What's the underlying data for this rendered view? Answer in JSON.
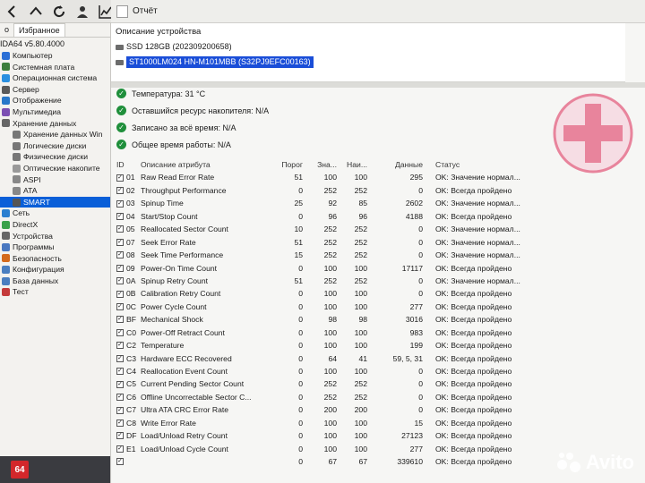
{
  "toolbar": {
    "buttons": [
      "back-icon",
      "up-icon",
      "refresh-icon",
      "user-icon",
      "chart-icon"
    ]
  },
  "report_bar": {
    "label": "Отчёт"
  },
  "sidebar": {
    "tabs": [
      "о",
      "Избранное"
    ],
    "app_version": "IDA64 v5.80.4000",
    "items": [
      {
        "label": "Компьютер",
        "indent": 1,
        "icon": "computer-icon",
        "color": "#2b6fd6"
      },
      {
        "label": "Системная плата",
        "indent": 1,
        "icon": "motherboard-icon",
        "color": "#3d7f3d"
      },
      {
        "label": "Операционная система",
        "indent": 1,
        "icon": "windows-icon",
        "color": "#2a8fe0"
      },
      {
        "label": "Сервер",
        "indent": 1,
        "icon": "server-icon",
        "color": "#5a5a5a"
      },
      {
        "label": "Отображение",
        "indent": 1,
        "icon": "display-icon",
        "color": "#2877c9"
      },
      {
        "label": "Мультимедиа",
        "indent": 1,
        "icon": "multimedia-icon",
        "color": "#7b4fb3"
      },
      {
        "label": "Хранение данных",
        "indent": 1,
        "icon": "storage-icon",
        "color": "#666666"
      },
      {
        "label": "Хранение данных Win",
        "indent": 2,
        "icon": "disk-icon",
        "color": "#777777"
      },
      {
        "label": "Логические диски",
        "indent": 2,
        "icon": "disk-icon",
        "color": "#777777"
      },
      {
        "label": "Физические диски",
        "indent": 2,
        "icon": "disk-icon",
        "color": "#777777"
      },
      {
        "label": "Оптические накопите",
        "indent": 2,
        "icon": "optical-icon",
        "color": "#999999"
      },
      {
        "label": "ASPI",
        "indent": 2,
        "icon": "aspi-icon",
        "color": "#888888"
      },
      {
        "label": "ATA",
        "indent": 2,
        "icon": "ata-icon",
        "color": "#888888"
      },
      {
        "label": "SMART",
        "indent": 2,
        "icon": "smart-icon",
        "color": "#555555",
        "selected": true
      },
      {
        "label": "Сеть",
        "indent": 1,
        "icon": "network-icon",
        "color": "#2b7fd0"
      },
      {
        "label": "DirectX",
        "indent": 1,
        "icon": "directx-icon",
        "color": "#3aa14a"
      },
      {
        "label": "Устройства",
        "indent": 1,
        "icon": "devices-icon",
        "color": "#666666"
      },
      {
        "label": "Программы",
        "indent": 1,
        "icon": "programs-icon",
        "color": "#4a78c0"
      },
      {
        "label": "Безопасность",
        "indent": 1,
        "icon": "security-icon",
        "color": "#d46a1c"
      },
      {
        "label": "Конфигурация",
        "indent": 1,
        "icon": "config-icon",
        "color": "#4a7ec0"
      },
      {
        "label": "База данных",
        "indent": 1,
        "icon": "database-icon",
        "color": "#4a7ec0"
      },
      {
        "label": "Тест",
        "indent": 1,
        "icon": "test-icon",
        "color": "#c43a3a"
      }
    ],
    "badge": "64"
  },
  "description": {
    "title": "Описание устройства",
    "devices": [
      {
        "label": "SSD 128GB (202309200658)",
        "selected": false
      },
      {
        "label": "ST1000LM024 HN-M101MBB (S32PJ9EFC00163)",
        "selected": true
      }
    ]
  },
  "status": [
    {
      "label": "Температура: 31 °C"
    },
    {
      "label": "Оставшийся ресурс накопителя: N/A"
    },
    {
      "label": "Записано за всё время: N/A"
    },
    {
      "label": "Общее время работы: N/A"
    }
  ],
  "table": {
    "headers": {
      "id": "ID",
      "name": "Описание атрибута",
      "threshold": "Порог",
      "value": "Зна...",
      "worst": "Наи...",
      "data": "Данные",
      "status": "Статус"
    },
    "rows": [
      {
        "id": "01",
        "name": "Raw Read Error Rate",
        "threshold": "51",
        "value": "100",
        "worst": "100",
        "data": "295",
        "status": "OK: Значение нормал..."
      },
      {
        "id": "02",
        "name": "Throughput Performance",
        "threshold": "0",
        "value": "252",
        "worst": "252",
        "data": "0",
        "status": "OK: Всегда пройдено"
      },
      {
        "id": "03",
        "name": "Spinup Time",
        "threshold": "25",
        "value": "92",
        "worst": "85",
        "data": "2602",
        "status": "OK: Значение нормал..."
      },
      {
        "id": "04",
        "name": "Start/Stop Count",
        "threshold": "0",
        "value": "96",
        "worst": "96",
        "data": "4188",
        "status": "OK: Всегда пройдено"
      },
      {
        "id": "05",
        "name": "Reallocated Sector Count",
        "threshold": "10",
        "value": "252",
        "worst": "252",
        "data": "0",
        "status": "OK: Значение нормал..."
      },
      {
        "id": "07",
        "name": "Seek Error Rate",
        "threshold": "51",
        "value": "252",
        "worst": "252",
        "data": "0",
        "status": "OK: Значение нормал..."
      },
      {
        "id": "08",
        "name": "Seek Time Performance",
        "threshold": "15",
        "value": "252",
        "worst": "252",
        "data": "0",
        "status": "OK: Значение нормал..."
      },
      {
        "id": "09",
        "name": "Power-On Time Count",
        "threshold": "0",
        "value": "100",
        "worst": "100",
        "data": "17117",
        "status": "OK: Всегда пройдено"
      },
      {
        "id": "0A",
        "name": "Spinup Retry Count",
        "threshold": "51",
        "value": "252",
        "worst": "252",
        "data": "0",
        "status": "OK: Значение нормал..."
      },
      {
        "id": "0B",
        "name": "Calibration Retry Count",
        "threshold": "0",
        "value": "100",
        "worst": "100",
        "data": "0",
        "status": "OK: Всегда пройдено"
      },
      {
        "id": "0C",
        "name": "Power Cycle Count",
        "threshold": "0",
        "value": "100",
        "worst": "100",
        "data": "277",
        "status": "OK: Всегда пройдено"
      },
      {
        "id": "BF",
        "name": "Mechanical Shock",
        "threshold": "0",
        "value": "98",
        "worst": "98",
        "data": "3016",
        "status": "OK: Всегда пройдено"
      },
      {
        "id": "C0",
        "name": "Power-Off Retract Count",
        "threshold": "0",
        "value": "100",
        "worst": "100",
        "data": "983",
        "status": "OK: Всегда пройдено"
      },
      {
        "id": "C2",
        "name": "Temperature",
        "threshold": "0",
        "value": "100",
        "worst": "100",
        "data": "199",
        "status": "OK: Всегда пройдено"
      },
      {
        "id": "C3",
        "name": "Hardware ECC Recovered",
        "threshold": "0",
        "value": "64",
        "worst": "41",
        "data": "59, 5, 31",
        "status": "OK: Всегда пройдено"
      },
      {
        "id": "C4",
        "name": "Reallocation Event Count",
        "threshold": "0",
        "value": "100",
        "worst": "100",
        "data": "0",
        "status": "OK: Всегда пройдено"
      },
      {
        "id": "C5",
        "name": "Current Pending Sector Count",
        "threshold": "0",
        "value": "252",
        "worst": "252",
        "data": "0",
        "status": "OK: Всегда пройдено"
      },
      {
        "id": "C6",
        "name": "Offline Uncorrectable Sector C...",
        "threshold": "0",
        "value": "252",
        "worst": "252",
        "data": "0",
        "status": "OK: Всегда пройдено"
      },
      {
        "id": "C7",
        "name": "Ultra ATA CRC Error Rate",
        "threshold": "0",
        "value": "200",
        "worst": "200",
        "data": "0",
        "status": "OK: Всегда пройдено"
      },
      {
        "id": "C8",
        "name": "Write Error Rate",
        "threshold": "0",
        "value": "100",
        "worst": "100",
        "data": "15",
        "status": "OK: Всегда пройдено"
      },
      {
        "id": "DF",
        "name": "Load/Unload Retry Count",
        "threshold": "0",
        "value": "100",
        "worst": "100",
        "data": "27123",
        "status": "OK: Всегда пройдено"
      },
      {
        "id": "E1",
        "name": "Load/Unload Cycle Count",
        "threshold": "0",
        "value": "100",
        "worst": "100",
        "data": "277",
        "status": "OK: Всегда пройдено"
      },
      {
        "id": "",
        "name": "",
        "threshold": "0",
        "value": "67",
        "worst": "67",
        "data": "339610",
        "status": "OK: Всегда пройдено"
      }
    ]
  },
  "watermark": {
    "text": "Avito"
  },
  "colors": {
    "selection": "#1a4ed8",
    "ok_green": "#1f8f3b",
    "health_cross": "#e8849c"
  }
}
